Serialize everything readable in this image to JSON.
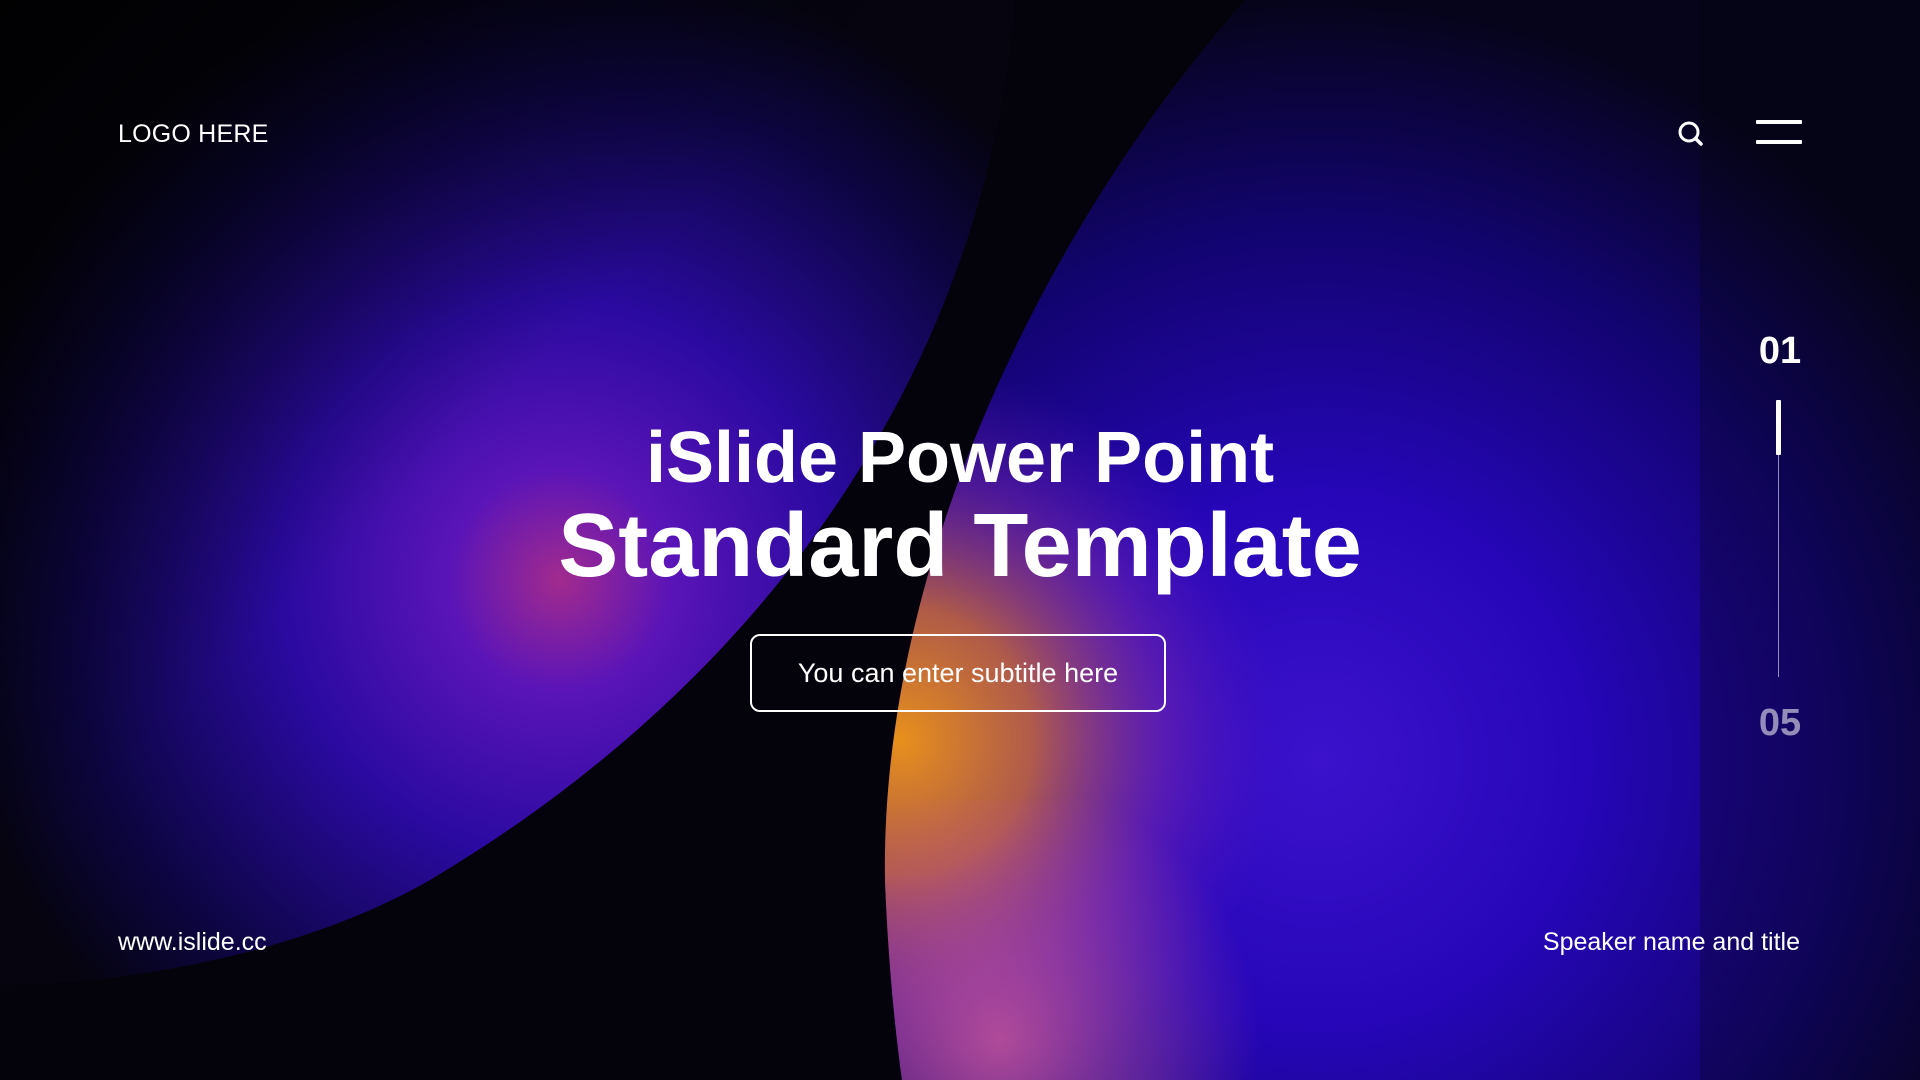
{
  "header": {
    "logo_text": "LOGO HERE",
    "search_icon": "search-icon",
    "menu_icon": "hamburger-menu-icon"
  },
  "title": {
    "line1": "iSlide Power Point",
    "line2": "Standard Template"
  },
  "subtitle": {
    "text": "You can enter subtitle here"
  },
  "pagination": {
    "current": "01",
    "total": "05",
    "progress_fraction": 0.2
  },
  "footer": {
    "website": "www.islide.cc",
    "speaker": "Speaker name and title"
  },
  "colors": {
    "background": "#04030c",
    "accent_purple": "#3a0fd0",
    "accent_orange": "#e8901c",
    "text": "#ffffff"
  }
}
